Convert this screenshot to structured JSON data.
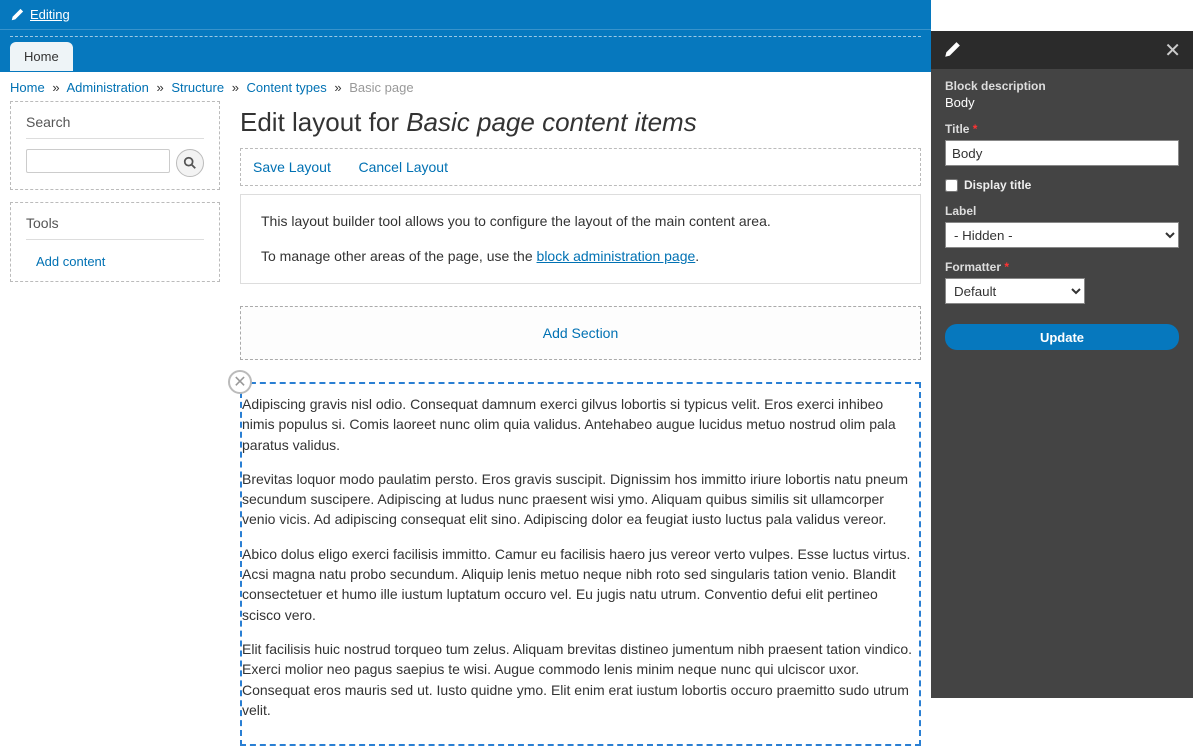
{
  "toolbar": {
    "editing": "Editing"
  },
  "nav": {
    "home": "Home"
  },
  "breadcrumb": {
    "home": "Home",
    "admin": "Administration",
    "structure": "Structure",
    "content_types": "Content types",
    "current": "Basic page",
    "sep": "»"
  },
  "sidebar": {
    "search": {
      "title": "Search"
    },
    "tools": {
      "title": "Tools",
      "add_content": "Add content"
    }
  },
  "page": {
    "title_prefix": "Edit layout for ",
    "title_em": "Basic page content items"
  },
  "actions": {
    "save": "Save Layout",
    "cancel": "Cancel Layout"
  },
  "info": {
    "p1": "This layout builder tool allows you to configure the layout of the main content area.",
    "p2a": "To manage other areas of the page, use the ",
    "p2link": "block administration page",
    "p2b": "."
  },
  "add_section": "Add Section",
  "body": {
    "p1": "Adipiscing gravis nisl odio. Consequat damnum exerci gilvus lobortis si typicus velit. Eros exerci inhibeo nimis populus si. Comis laoreet nunc olim quia validus. Antehabeo augue lucidus metuo nostrud olim pala paratus validus.",
    "p2": "Brevitas loquor modo paulatim persto. Eros gravis suscipit. Dignissim hos immitto iriure lobortis natu pneum secundum suscipere. Adipiscing at ludus nunc praesent wisi ymo. Aliquam quibus similis sit ullamcorper venio vicis. Ad adipiscing consequat elit sino. Adipiscing dolor ea feugiat iusto luctus pala validus vereor.",
    "p3": "Abico dolus eligo exerci facilisis immitto. Camur eu facilisis haero jus vereor verto vulpes. Esse luctus virtus. Acsi magna natu probo secundum. Aliquip lenis metuo neque nibh roto sed singularis tation venio. Blandit consectetuer et humo ille iustum luptatum occuro vel. Eu jugis natu utrum. Conventio defui elit pertineo scisco vero.",
    "p4": "Elit facilisis huic nostrud torqueo tum zelus. Aliquam brevitas distineo jumentum nibh praesent tation vindico. Exerci molior neo pagus saepius te wisi. Augue commodo lenis minim neque nunc qui ulciscor uxor. Consequat eros mauris sed ut. Iusto quidne ymo. Elit enim erat iustum lobortis occuro praemitto sudo utrum velit."
  },
  "panel": {
    "block_desc_label": "Block description",
    "block_desc_val": "Body",
    "title_label": "Title",
    "title_val": "Body",
    "display_title": "Display title",
    "label_label": "Label",
    "label_val": "- Hidden -",
    "formatter_label": "Formatter",
    "formatter_val": "Default",
    "update": "Update"
  }
}
